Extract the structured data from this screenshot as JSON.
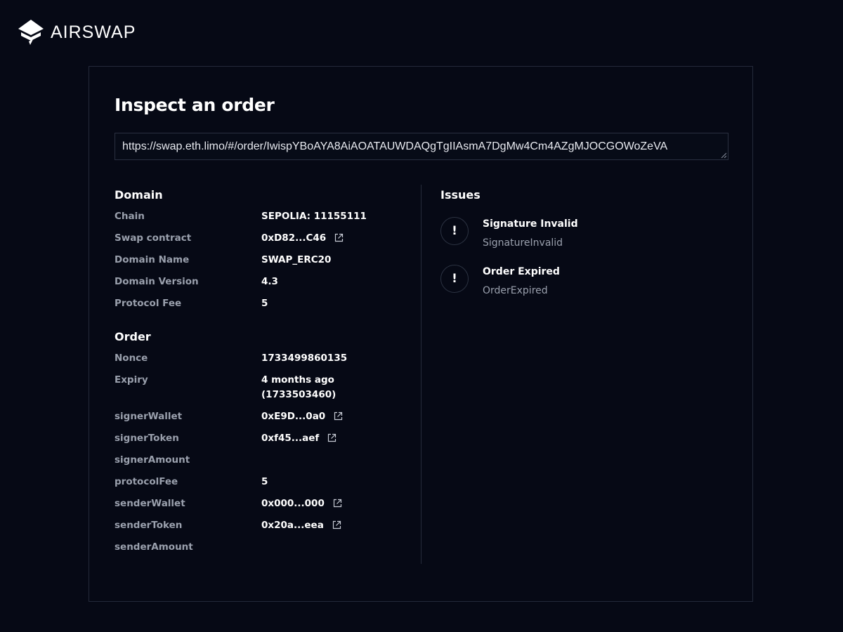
{
  "brand": {
    "name": "AIRSWAP"
  },
  "page": {
    "title": "Inspect an order",
    "url_value": "https://swap.eth.limo/#/order/IwispYBoAYA8AiAOATAUWDAQgTgIIAsmA7DgMw4Cm4AZgMJOCGOWoZeVA"
  },
  "domain": {
    "heading": "Domain",
    "rows": [
      {
        "key": "Chain",
        "value": "SEPOLIA: 11155111"
      },
      {
        "key": "Swap contract",
        "value": "0xD82...C46",
        "link": true
      },
      {
        "key": "Domain Name",
        "value": "SWAP_ERC20"
      },
      {
        "key": "Domain Version",
        "value": "4.3"
      },
      {
        "key": "Protocol Fee",
        "value": "5"
      }
    ]
  },
  "order": {
    "heading": "Order",
    "rows": [
      {
        "key": "Nonce",
        "value": "1733499860135"
      },
      {
        "key": "Expiry",
        "value": "4 months ago",
        "value2": "(1733503460)"
      },
      {
        "key": "signerWallet",
        "value": "0xE9D...0a0",
        "link": true
      },
      {
        "key": "signerToken",
        "value": "0xf45...aef",
        "link": true
      },
      {
        "key": "signerAmount",
        "value": ""
      },
      {
        "key": "protocolFee",
        "value": "5"
      },
      {
        "key": "senderWallet",
        "value": "0x000...000",
        "link": true
      },
      {
        "key": "senderToken",
        "value": "0x20a...eea",
        "link": true
      },
      {
        "key": "senderAmount",
        "value": ""
      }
    ]
  },
  "issues": {
    "heading": "Issues",
    "items": [
      {
        "icon": "!",
        "title": "Signature Invalid",
        "code": "SignatureInvalid"
      },
      {
        "icon": "!",
        "title": "Order Expired",
        "code": "OrderExpired"
      }
    ]
  },
  "colors": {
    "background": "#060915",
    "muted_text": "#9aa0ad",
    "border": "#242a3a"
  },
  "icons": {
    "link": "external-link-icon",
    "issue": "exclamation-icon",
    "logo": "airswap-logo-icon"
  }
}
